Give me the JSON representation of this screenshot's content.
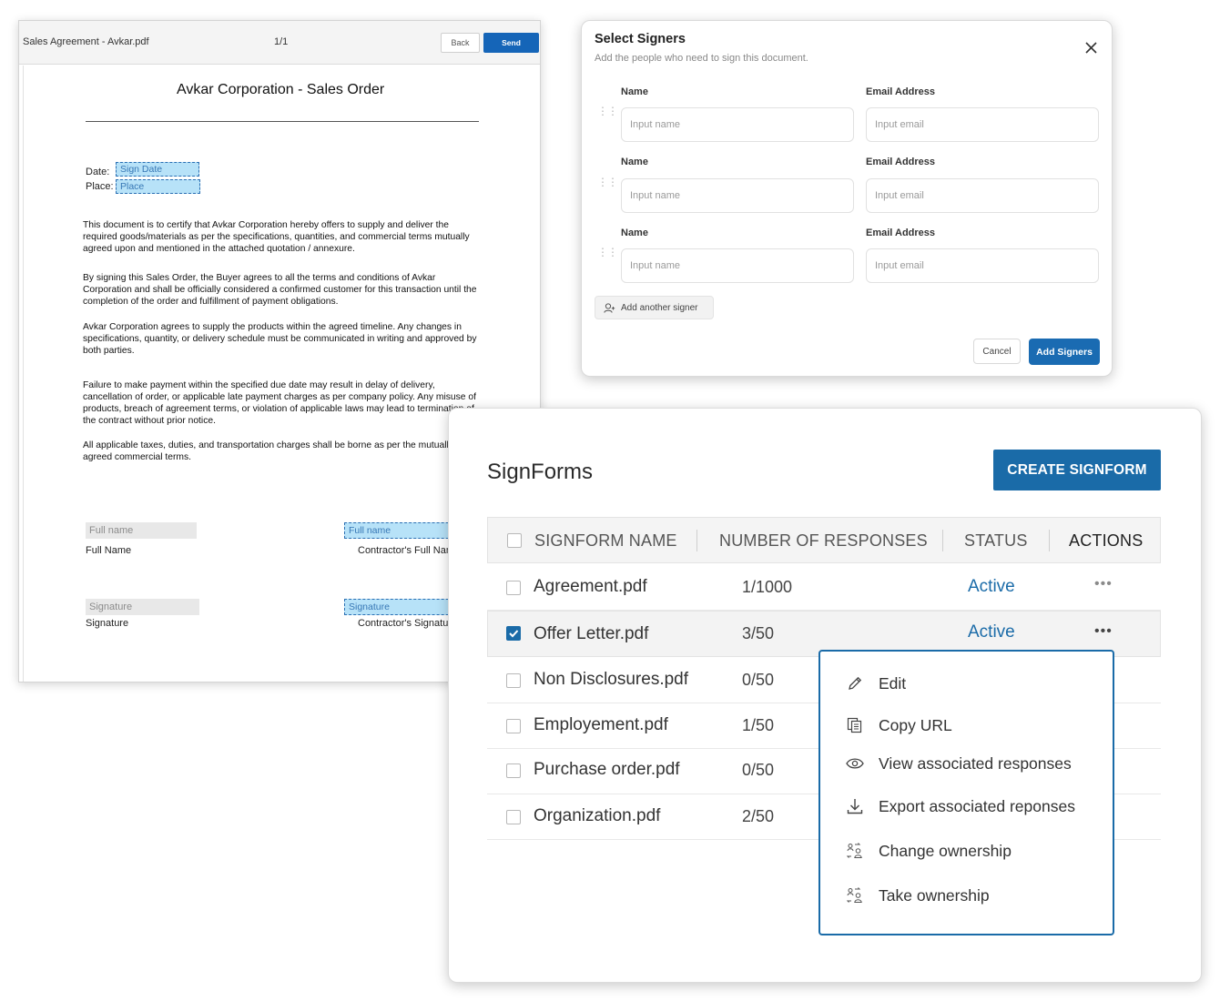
{
  "pdf_editor": {
    "file_title": "Sales Agreement - Avkar.pdf",
    "page_indicator": "1/1",
    "back_label": "Back",
    "send_label": "Send",
    "document": {
      "title": "Avkar Corporation - Sales Order",
      "date_label": "Date:",
      "date_field": "Sign Date",
      "place_label": "Place:",
      "place_field": "Place",
      "paragraphs": [
        "This document is to certify that Avkar Corporation hereby offers to supply and deliver the required goods/materials as per the specifications, quantities, and commercial terms mutually agreed upon and mentioned in the attached quotation / annexure.",
        "By signing this Sales Order, the Buyer agrees to all the terms and conditions of Avkar Corporation and shall be officially considered a confirmed customer for this transaction until the completion of the order and fulfillment of payment obligations.",
        "Avkar Corporation agrees to supply the products within the agreed timeline. Any changes in specifications, quantity, or delivery schedule must be communicated in writing and approved by both parties.",
        "Failure to make payment within the specified due date may result in delay of delivery, cancellation of order, or applicable late payment charges as per company policy. Any misuse of products, breach of agreement terms, or violation of applicable laws may lead to termination of the contract without prior notice.",
        "All applicable taxes, duties, and transportation charges shall be borne as per the mutually agreed commercial terms."
      ],
      "fullname_field_left": "Full name",
      "fullname_caption_left": "Full Name",
      "fullname_field_right": "Full name",
      "fullname_caption_right": "Contractor's Full Name",
      "signature_field_left": "Signature",
      "signature_caption_left": "Signature",
      "signature_field_right": "Signature",
      "signature_caption_right": "Contractor's Signature"
    }
  },
  "signers_dialog": {
    "title": "Select Signers",
    "subtitle": "Add the people who need to sign this document.",
    "close_icon": "close-icon",
    "rows": [
      {
        "name_label": "Name",
        "email_label": "Email Address",
        "name_placeholder": "Input name",
        "email_placeholder": "Input email"
      },
      {
        "name_label": "Name",
        "email_label": "Email Address",
        "name_placeholder": "Input name",
        "email_placeholder": "Input email"
      },
      {
        "name_label": "Name",
        "email_label": "Email Address",
        "name_placeholder": "Input name",
        "email_placeholder": "Input email"
      }
    ],
    "add_signer_label": "Add another signer",
    "cancel_label": "Cancel",
    "add_signers_label": "Add Signers"
  },
  "signforms": {
    "title": "SignForms",
    "create_label": "CREATE SIGNFORM",
    "columns": {
      "name": "SIGNFORM NAME",
      "responses": "NUMBER OF RESPONSES",
      "status": "STATUS",
      "actions": "ACTIONS"
    },
    "rows": [
      {
        "name": "Agreement.pdf",
        "responses": "1/1000",
        "status": "Active",
        "checked": false
      },
      {
        "name": "Offer Letter.pdf",
        "responses": "3/50",
        "status": "Active",
        "checked": true
      },
      {
        "name": "Non Disclosures.pdf",
        "responses": "0/50",
        "status": "",
        "checked": false
      },
      {
        "name": "Employement.pdf",
        "responses": "1/50",
        "status": "",
        "checked": false
      },
      {
        "name": "Purchase order.pdf",
        "responses": "0/50",
        "status": "",
        "checked": false
      },
      {
        "name": "Organization.pdf",
        "responses": "2/50",
        "status": "",
        "checked": false
      }
    ],
    "actions_menu": [
      {
        "label": "Edit",
        "icon": "pencil-icon"
      },
      {
        "label": "Copy URL",
        "icon": "copy-icon"
      },
      {
        "label": "View associated responses",
        "icon": "eye-icon"
      },
      {
        "label": "Export associated reponses",
        "icon": "download-icon"
      },
      {
        "label": "Change ownership",
        "icon": "ownership-icon"
      },
      {
        "label": "Take ownership",
        "icon": "ownership-icon"
      }
    ]
  },
  "colors": {
    "primary": "#1a6ba8",
    "field_highlight": "#b7e2f8"
  }
}
